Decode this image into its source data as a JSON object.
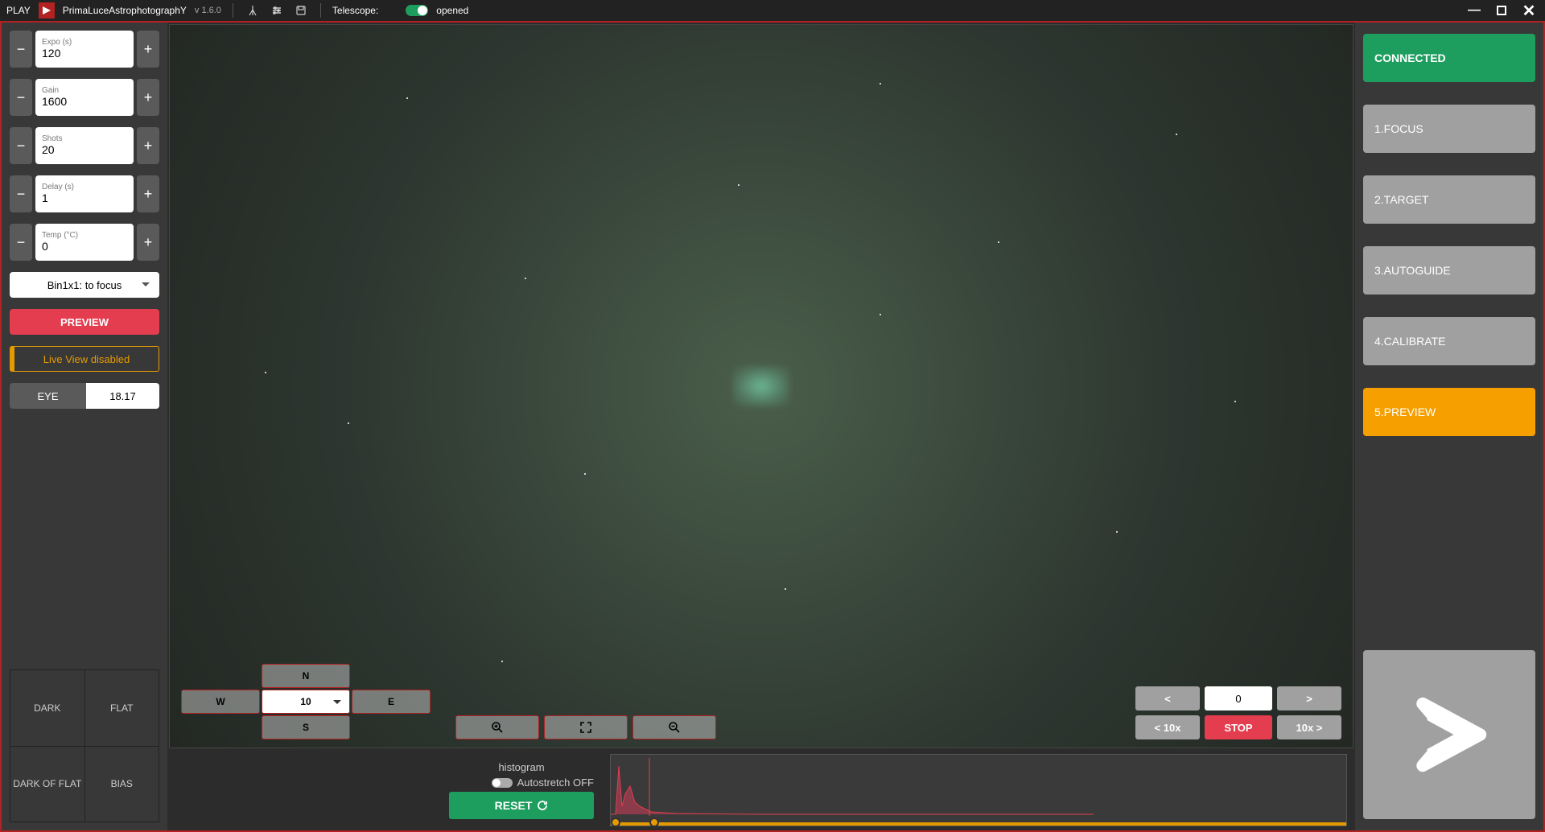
{
  "app": {
    "name_prefix": "PLAY",
    "name": "PrimaLuceAstrophotographY",
    "version": "v 1.6.0"
  },
  "topbar": {
    "telescope_label": "Telescope:",
    "telescope_status": "opened"
  },
  "left": {
    "expo": {
      "label": "Expo (s)",
      "value": "120"
    },
    "gain": {
      "label": "Gain",
      "value": "1600"
    },
    "shots": {
      "label": "Shots",
      "value": "20"
    },
    "delay": {
      "label": "Delay (s)",
      "value": "1"
    },
    "temp": {
      "label": "Temp (°C)",
      "value": "0"
    },
    "binning": "Bin1x1: to focus",
    "preview_btn": "PREVIEW",
    "liveview": "Live View disabled",
    "eye_label": "EYE",
    "eye_value": "18.17",
    "calib": {
      "dark": "DARK",
      "flat": "FLAT",
      "dark_of_flat": "DARK OF FLAT",
      "bias": "BIAS"
    }
  },
  "center": {
    "dpad": {
      "n": "N",
      "s": "S",
      "e": "E",
      "w": "W",
      "rate": "10"
    },
    "shift": {
      "left": "<",
      "value": "0",
      "right": ">",
      "left10": "< 10x",
      "stop": "STOP",
      "right10": "10x >"
    },
    "histogram": {
      "title": "histogram",
      "autostretch": "Autostretch OFF",
      "reset": "RESET"
    }
  },
  "right": {
    "connected": "CONNECTED",
    "steps": [
      "1.FOCUS",
      "2.TARGET",
      "3.AUTOGUIDE",
      "4.CALIBRATE",
      "5.PREVIEW"
    ],
    "active_step": 4
  }
}
